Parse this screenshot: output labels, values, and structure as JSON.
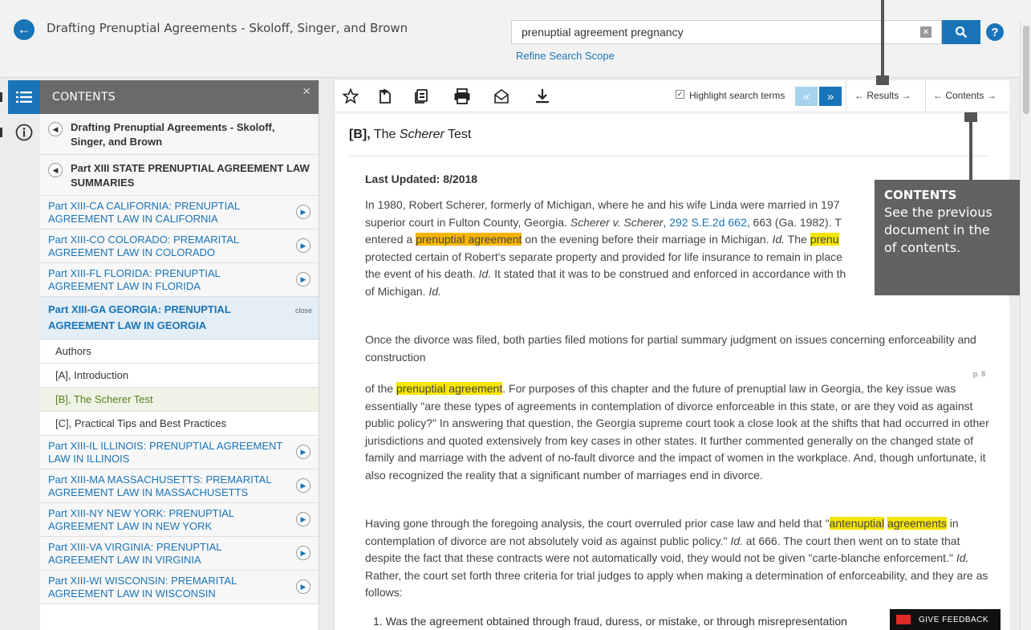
{
  "header": {
    "title": "Drafting Prenuptial Agreements - Skoloff, Singer, and Brown",
    "search_value": "prenuptial agreement pregnancy",
    "clear_label": "×",
    "help_label": "?",
    "refine_link": "Refine Search Scope"
  },
  "contents_panel": {
    "title": "CONTENTS",
    "close_label": "×",
    "parents": [
      "Drafting Prenuptial Agreements - Skoloff, Singer, and Brown",
      "Part XIII STATE PRENUPTIAL AGREEMENT LAW SUMMARIES"
    ],
    "items_before": [
      "Part XIII-CA CALIFORNIA: PRENUPTIAL AGREEMENT LAW IN CALIFORNIA",
      "Part XIII-CO COLORADO: PREMARITAL AGREEMENT LAW IN COLORADO",
      "Part XIII-FL FLORIDA: PRENUPTIAL AGREEMENT LAW IN FLORIDA"
    ],
    "open_item": {
      "label": "Part XIII-GA GEORGIA: PRENUPTIAL AGREEMENT LAW IN GEORGIA",
      "close_label": "close"
    },
    "subitems": [
      "Authors",
      "[A], Introduction",
      "[B], The Scherer Test",
      "[C], Practical Tips and Best Practices"
    ],
    "items_after": [
      "Part XIII-IL ILLINOIS: PRENUPTIAL AGREEMENT LAW IN ILLINOIS",
      "Part XIII-MA MASSACHUSETTS: PREMARITAL AGREEMENT LAW IN MASSACHUSETTS",
      "Part XIII-NY NEW YORK: PRENUPTIAL AGREEMENT LAW IN NEW YORK",
      "Part XIII-VA VIRGINIA: PRENUPTIAL AGREEMENT LAW IN VIRGINIA",
      "Part XIII-WI WISCONSIN: PREMARITAL AGREEMENT LAW IN WISCONSIN"
    ]
  },
  "toolbar": {
    "highlight_label": "Highlight search terms",
    "highlight_checked": "✓",
    "prev_hit": "«",
    "next_hit": "»",
    "results_label": "← Results →",
    "contents_label": "← Contents →"
  },
  "document": {
    "heading_prefix": "[B],",
    "heading_the": " The ",
    "heading_em": "Scherer",
    "heading_suffix": " Test",
    "last_updated": "Last Updated: 8/2018",
    "p1": {
      "a": "In 1980, Robert Scherer, formerly of Michigan, where he and his wife Linda were married in 197",
      "b": "superior court in Fulton County, Georgia. ",
      "case": "Scherer v. Scherer",
      "comma": ", ",
      "cite": "292 S.E.2d 662",
      "c": ", 663 (Ga. 1982). T",
      "d": "entered a ",
      "hl1": "prenuptial agreement",
      "e": " on the evening before their marriage in Michigan. ",
      "id1": "Id.",
      "f": " The ",
      "hl2": "prenu",
      "g": "protected certain of Robert's separate property and provided for life insurance to remain in place",
      "h": "the event of his death. ",
      "id2": "Id.",
      "i": " It stated that it was to be construed and enforced in accordance with th",
      "j": "of Michigan. ",
      "id3": "Id."
    },
    "p2": "Once the divorce was filed, both parties filed motions for partial summary judgment on issues concerning enforceability and construction",
    "page_marker": "p. 8",
    "p3": {
      "a": "of the ",
      "hl": "prenuptial agreement",
      "b": ". For purposes of this chapter and the future of prenuptial law in Georgia, the key issue was essentially \"are these types of agreements in contemplation of divorce enforceable in this state, or are they void as against public policy?\" In answering that question, the Georgia supreme court took a close look at the shifts that had occurred in other jurisdictions and quoted extensively from key cases in other states. It further commented generally on the changed state of family and marriage with the advent of no-fault divorce and the impact of women in the workplace. And, though unfortunate, it also recognized the reality that a significant number of marriages end in divorce."
    },
    "p4": {
      "a": "Having gone through the foregoing analysis, the court overruled prior case law and held that \"",
      "hl1": "antenuptial",
      "hl2": "agreements",
      "b": " in contemplation of divorce are not absolutely void as against public policy.\" ",
      "id1": "Id.",
      "c": " at 666. The court then went on to state that despite the fact that these contracts were not automatically void, they would not be given \"carte-blanche enforcement.\" ",
      "id2": "Id.",
      "d": " Rather, the court set forth three criteria for trial judges to apply when making a determination of enforceability, and they are as follows:"
    },
    "list_item": "1.  Was the agreement obtained through fraud, duress, or mistake, or through misrepresentation"
  },
  "callout": {
    "title": "CONTENTS",
    "lines": [
      "See the previous",
      "document in the",
      "of contents."
    ]
  },
  "feedback": {
    "label": "GIVE FEEDBACK"
  },
  "colors": {
    "accent": "#1a74b8",
    "highlight": "#f5e500",
    "current_highlight": "#f7b500",
    "panel_header": "#6a6a6a"
  }
}
